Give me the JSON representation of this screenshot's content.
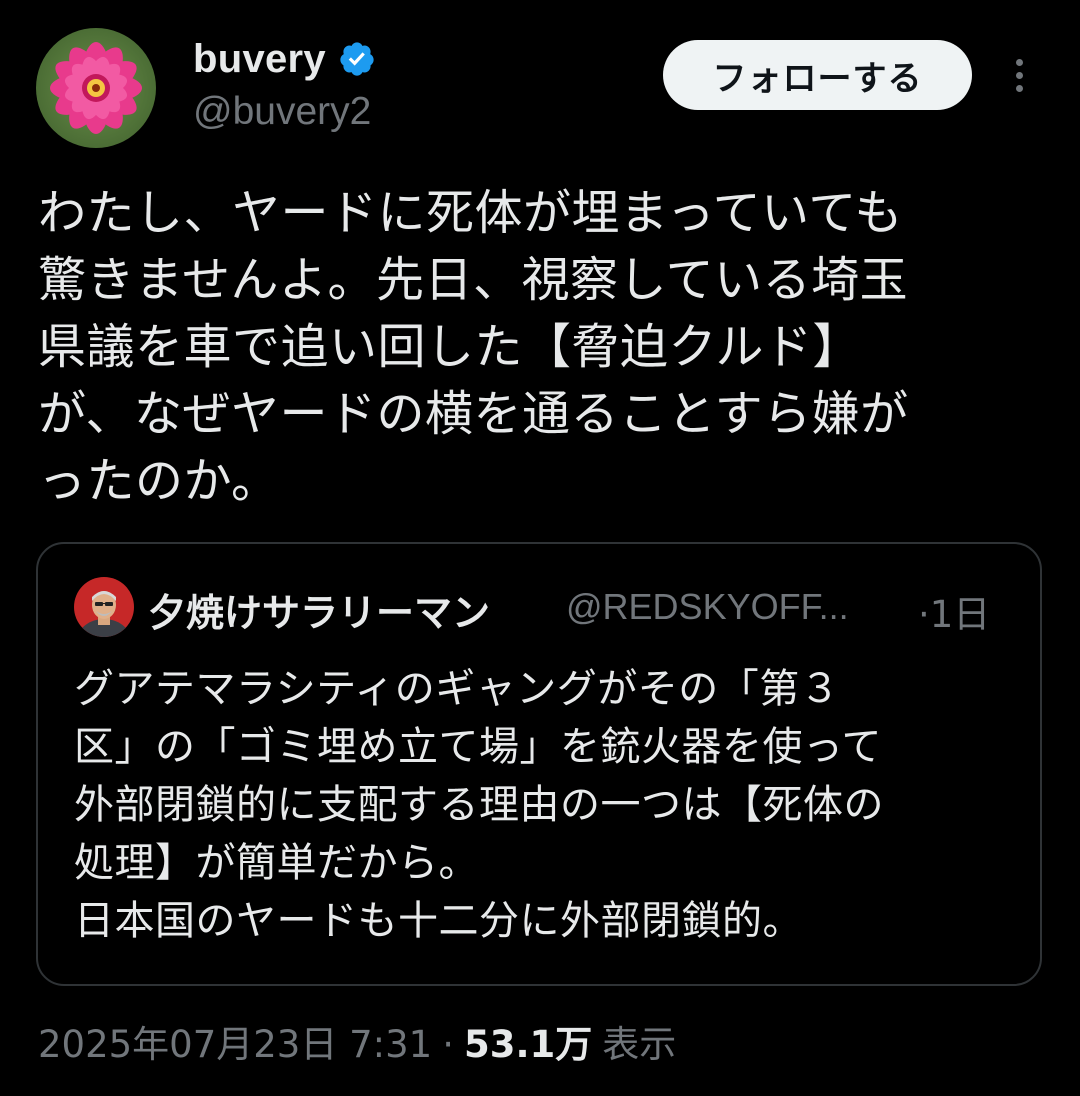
{
  "author": {
    "name": "buvery",
    "handle": "@buvery2",
    "verified": true
  },
  "actions": {
    "follow_label": "フォローする"
  },
  "tweet": {
    "text": "わたし、ヤードに死体が埋まっていても\n驚きませんよ。先日、視察している埼玉\n県議を車で追い回した【脅迫クルド】\nが、なぜヤードの横を通ることすら嫌が\nったのか。"
  },
  "quote": {
    "name": "夕焼けサラリーマン",
    "handle": "@REDSKYOFF...",
    "time": "·1日",
    "text": "グアテマラシティのギャングがその「第３\n区」の「ゴミ埋め立て場」を銃火器を使って\n外部閉鎖的に支配する理由の一つは【死体の\n処理】が簡単だから。\n日本国のヤードも十二分に外部閉鎖的。"
  },
  "meta": {
    "timestamp": "2025年07月23日 7:31",
    "separator": "·",
    "views_count": "53.1万",
    "views_label": "表示"
  },
  "colors": {
    "background": "#000000",
    "text": "#e7e9ea",
    "secondary": "#71767b",
    "verified_blue": "#1d9bf0",
    "border": "#2f3336"
  }
}
